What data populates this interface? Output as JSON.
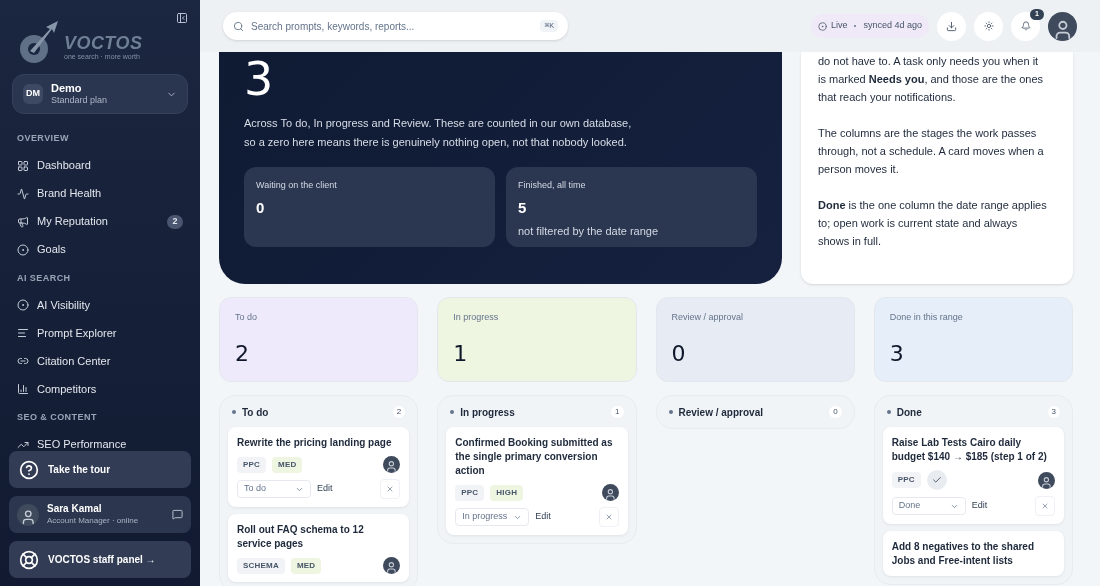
{
  "sidebar": {
    "logo": {
      "name": "VOCTOS",
      "tagline": "one search · more worth"
    },
    "workspace": {
      "initials": "DM",
      "name": "Demo",
      "plan": "Standard plan"
    },
    "sections": [
      {
        "heading": "OVERVIEW",
        "items": [
          {
            "label": "Dashboard"
          },
          {
            "label": "Brand Health"
          },
          {
            "label": "My Reputation",
            "badge": "2"
          },
          {
            "label": "Goals"
          }
        ]
      },
      {
        "heading": "AI SEARCH",
        "items": [
          {
            "label": "AI Visibility"
          },
          {
            "label": "Prompt Explorer"
          },
          {
            "label": "Citation Center"
          },
          {
            "label": "Competitors"
          }
        ]
      },
      {
        "heading": "SEO & CONTENT",
        "items": [
          {
            "label": "SEO Performance"
          }
        ]
      }
    ],
    "tour": "Take the tour",
    "manager": {
      "name": "Sara Kamal",
      "role": "Account Manager · online"
    },
    "staff": "VOCTOS staff panel →"
  },
  "header": {
    "search": {
      "placeholder": "Search prompts, keywords, reports...",
      "shortcut": "⌘K"
    },
    "status": {
      "live": "Live",
      "synced": "synced 4d ago"
    },
    "notifications": "1"
  },
  "hero": {
    "value": "3",
    "text": "Across To do, In progress and Review. These are counted in our own database, so a zero here means there is genuinely nothing open, not that nobody looked.",
    "stats": [
      {
        "label": "Waiting on the client",
        "value": "0"
      },
      {
        "label": "Finished, all time",
        "value": "5",
        "note": "not filtered by the date range"
      }
    ]
  },
  "info": [
    "do not have to. A task only needs you when it is marked **Needs you**, and those are the ones that reach your notifications.",
    "The columns are the stages the work passes through, not a schedule. A card moves when a person moves it.",
    "**Done** is the one column the date range applies to; open work is current state and always shows in full."
  ],
  "summary": [
    {
      "label": "To do",
      "value": "2",
      "color": "#efeafb"
    },
    {
      "label": "In progress",
      "value": "1",
      "color": "#eef5e1"
    },
    {
      "label": "Review / approval",
      "value": "0",
      "color": "#e7ebf3"
    },
    {
      "label": "Done in this range",
      "value": "3",
      "color": "#e5eef9"
    }
  ],
  "columns": [
    {
      "title": "To do",
      "count": "2",
      "cards": [
        {
          "title": "Rewrite the pricing landing page",
          "tags": [
            {
              "kind": "text",
              "text": "PPC",
              "color": "#f1f3f6"
            },
            {
              "kind": "text",
              "text": "MED",
              "color": "#eef5e1"
            }
          ],
          "status": "To do",
          "edit": "Edit"
        },
        {
          "title": "Roll out FAQ schema to 12 service pages",
          "tags": [
            {
              "kind": "text",
              "text": "SCHEMA",
              "color": "#f1f3f6"
            },
            {
              "kind": "text",
              "text": "MED",
              "color": "#eef5e1"
            }
          ]
        }
      ]
    },
    {
      "title": "In progress",
      "count": "1",
      "cards": [
        {
          "title": "Confirmed Booking submitted as the single primary conversion action",
          "tags": [
            {
              "kind": "text",
              "text": "PPC",
              "color": "#f1f3f6"
            },
            {
              "kind": "text",
              "text": "HIGH",
              "color": "#eef5e1"
            }
          ],
          "status": "In progress",
          "edit": "Edit"
        }
      ]
    },
    {
      "title": "Review / approval",
      "count": "0"
    },
    {
      "title": "Done",
      "count": "3",
      "cards": [
        {
          "title": "Raise Lab Tests Cairo daily budget $140 → $185 (step 1 of 2)",
          "tags": [
            {
              "kind": "text",
              "text": "PPC",
              "color": "#f1f3f6"
            },
            {
              "kind": "check",
              "color": "#e8ecf1"
            }
          ],
          "status": "Done",
          "edit": "Edit"
        },
        {
          "title": "Add 8 negatives to the shared Jobs and Free-intent lists"
        }
      ]
    }
  ]
}
